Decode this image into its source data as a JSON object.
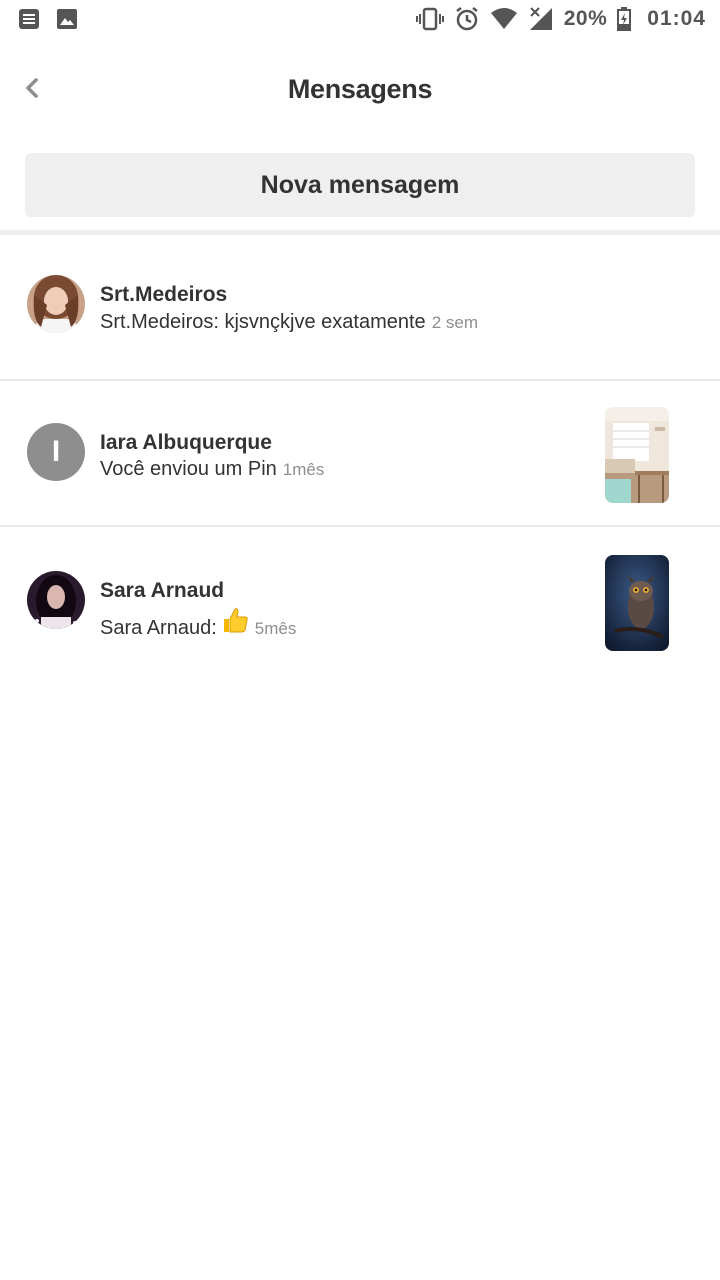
{
  "status_bar": {
    "battery": "20%",
    "time": "01:04",
    "left_icons": [
      "notes-icon",
      "image-icon"
    ],
    "right_icons": [
      "vibrate-icon",
      "alarm-icon",
      "wifi-icon",
      "signal-icon",
      "battery-icon"
    ]
  },
  "header": {
    "title": "Mensagens",
    "back_icon": "chevron-left-icon"
  },
  "new_message_label": "Nova mensagem",
  "conversations": [
    {
      "name": "Srt.Medeiros",
      "preview": "Srt.Medeiros: kjsvnçkjve exatamente",
      "time": "2 sem",
      "avatar": "photo"
    },
    {
      "name": "Iara Albuquerque",
      "preview": "Você enviou um Pin",
      "time": "1mês",
      "avatar_letter": "I",
      "thumbnail": "room-interior-pin"
    },
    {
      "name": "Sara Arnaud",
      "preview": "Sara Arnaud:",
      "preview_emoji": "thumbs-up-icon",
      "time": "5mês",
      "avatar": "photo",
      "thumbnail": "owl-pin"
    }
  ],
  "colors": {
    "text": "#333333",
    "muted": "#8e8e8e",
    "button_bg": "#efefef",
    "divider": "#e9e9e9"
  }
}
